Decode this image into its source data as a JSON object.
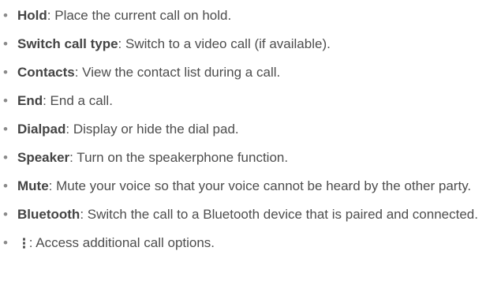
{
  "items": [
    {
      "term": "Hold",
      "desc": ": Place the current call on hold."
    },
    {
      "term": "Switch call type",
      "desc": ": Switch to a video call (if available)."
    },
    {
      "term": "Contacts",
      "desc": ": View the contact list during a call."
    },
    {
      "term": "End",
      "desc": ": End a call."
    },
    {
      "term": "Dialpad",
      "desc": ": Display or hide the dial pad."
    },
    {
      "term": "Speaker",
      "desc": ": Turn on the speakerphone function."
    },
    {
      "term": "Mute",
      "desc": ": Mute your voice so that your voice cannot be heard by the other party."
    },
    {
      "term": "Bluetooth",
      "desc": ": Switch the call to a Bluetooth device that is paired and connected."
    }
  ],
  "options_item": {
    "icon": "more-options-icon",
    "desc": " : Access additional call options."
  }
}
